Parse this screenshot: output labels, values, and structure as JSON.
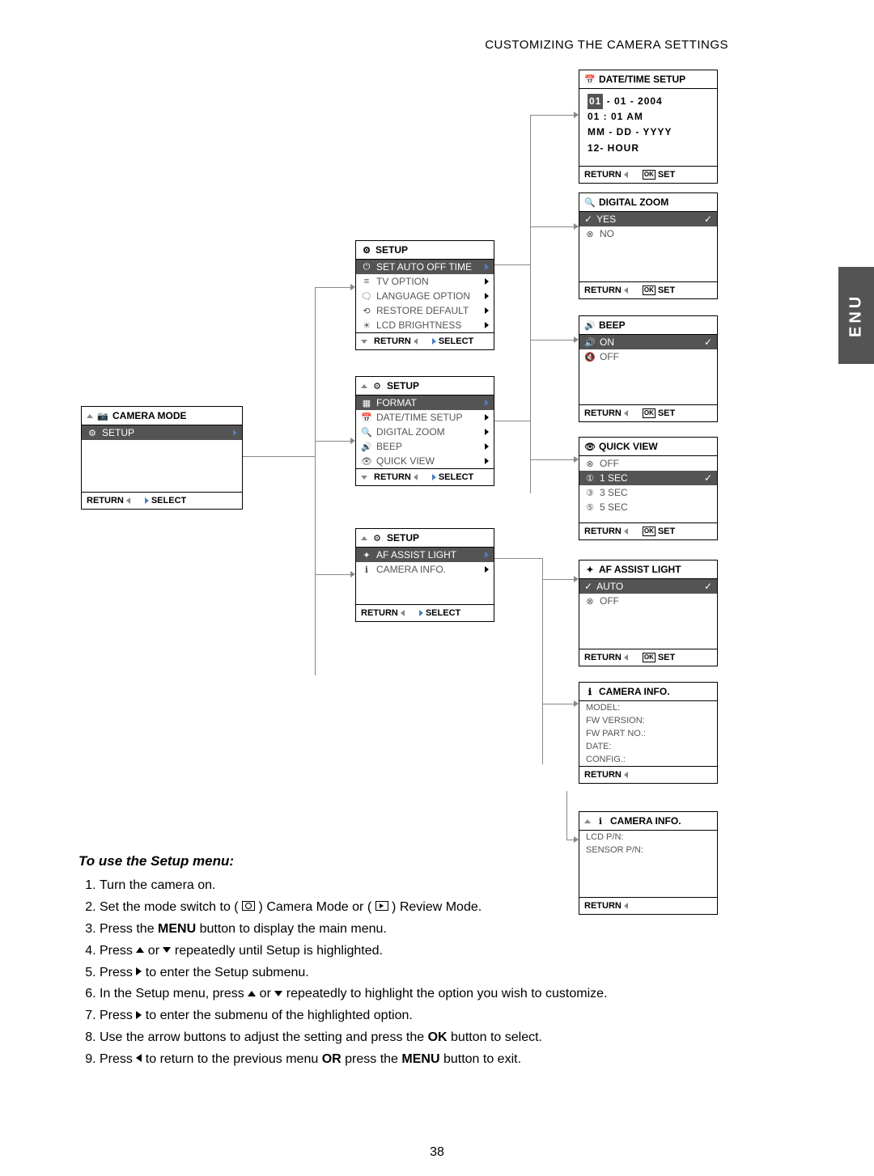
{
  "header": {
    "title": "CUSTOMIZING THE CAMERA SETTINGS"
  },
  "side_tab": "ENU",
  "page_number": "38",
  "camera_mode": {
    "title": "CAMERA MODE",
    "item": "SETUP",
    "footer": {
      "return": "RETURN",
      "select": "SELECT"
    }
  },
  "setup1": {
    "title": "SETUP",
    "items": [
      {
        "label": "SET AUTO OFF TIME",
        "hl": true
      },
      {
        "label": "TV OPTION"
      },
      {
        "label": "LANGUAGE OPTION"
      },
      {
        "label": "RESTORE DEFAULT"
      },
      {
        "label": "LCD BRIGHTNESS"
      }
    ],
    "footer": {
      "return": "RETURN",
      "select": "SELECT"
    }
  },
  "setup2": {
    "title": "SETUP",
    "items": [
      {
        "label": "FORMAT",
        "hl": true
      },
      {
        "label": "DATE/TIME SETUP"
      },
      {
        "label": "DIGITAL ZOOM"
      },
      {
        "label": "BEEP"
      },
      {
        "label": "QUICK VIEW"
      }
    ],
    "footer": {
      "return": "RETURN",
      "select": "SELECT"
    }
  },
  "setup3": {
    "title": "SETUP",
    "items": [
      {
        "label": "AF ASSIST LIGHT",
        "hl": true
      },
      {
        "label": "CAMERA INFO."
      }
    ],
    "footer": {
      "return": "RETURN",
      "select": "SELECT"
    }
  },
  "datetime": {
    "title": "DATE/TIME SETUP",
    "line1_hl": "01",
    "line1_rest": " -  01  -  2004",
    "line2": "01 : 01 AM",
    "line3": "MM - DD - YYYY",
    "line4": "12- HOUR",
    "footer": {
      "return": "RETURN",
      "set": "SET"
    }
  },
  "digital_zoom": {
    "title": "DIGITAL  ZOOM",
    "items": [
      {
        "label": "YES",
        "hl": true,
        "check": true
      },
      {
        "label": "NO"
      }
    ],
    "footer": {
      "return": "RETURN",
      "set": "SET"
    }
  },
  "beep": {
    "title": "BEEP",
    "items": [
      {
        "label": "ON",
        "hl": true,
        "check": true
      },
      {
        "label": "OFF"
      }
    ],
    "footer": {
      "return": "RETURN",
      "set": "SET"
    }
  },
  "quickview": {
    "title": "QUICK VIEW",
    "items": [
      {
        "label": "OFF"
      },
      {
        "label": "1 SEC",
        "hl": true,
        "check": true
      },
      {
        "label": "3 SEC"
      },
      {
        "label": "5 SEC"
      }
    ],
    "footer": {
      "return": "RETURN",
      "set": "SET"
    }
  },
  "afassist": {
    "title": "AF ASSIST LIGHT",
    "items": [
      {
        "label": "AUTO",
        "hl": true,
        "check": true
      },
      {
        "label": "OFF"
      }
    ],
    "footer": {
      "return": "RETURN",
      "set": "SET"
    }
  },
  "camerainfo1": {
    "title": "CAMERA  INFO.",
    "lines": [
      "MODEL:",
      "FW VERSION:",
      "FW PART NO.:",
      "DATE:",
      "CONFIG.:"
    ],
    "footer": {
      "return": "RETURN"
    }
  },
  "camerainfo2": {
    "title": "CAMERA  INFO.",
    "lines": [
      "LCD P/N:",
      "SENSOR P/N:"
    ],
    "footer": {
      "return": "RETURN"
    }
  },
  "instructions": {
    "heading": "To use  the Setup menu:",
    "steps": {
      "s1": "Turn the camera on.",
      "s2a": "Set the mode switch to (",
      "s2b": ") Camera Mode or (",
      "s2c": ") Review Mode.",
      "s3a": "Press the ",
      "s3b": "MENU",
      "s3c": " button to display the main menu.",
      "s4a": "Press ",
      "s4b": " or ",
      "s4c": " repeatedly until Setup is highlighted.",
      "s5a": "Press ",
      "s5b": " to enter the Setup submenu.",
      "s6a": "In the Setup menu, press ",
      "s6b": " or ",
      "s6c": " repeatedly to highlight the option you wish to customize.",
      "s7a": "Press ",
      "s7b": " to enter the submenu of the highlighted option.",
      "s8a": "Use the arrow buttons to adjust the setting and press the ",
      "s8b": "OK",
      "s8c": " button to select.",
      "s9a": "Press ",
      "s9b": " to return to the previous menu ",
      "s9c": "OR",
      "s9d": " press the ",
      "s9e": "MENU",
      "s9f": " button to exit."
    }
  }
}
